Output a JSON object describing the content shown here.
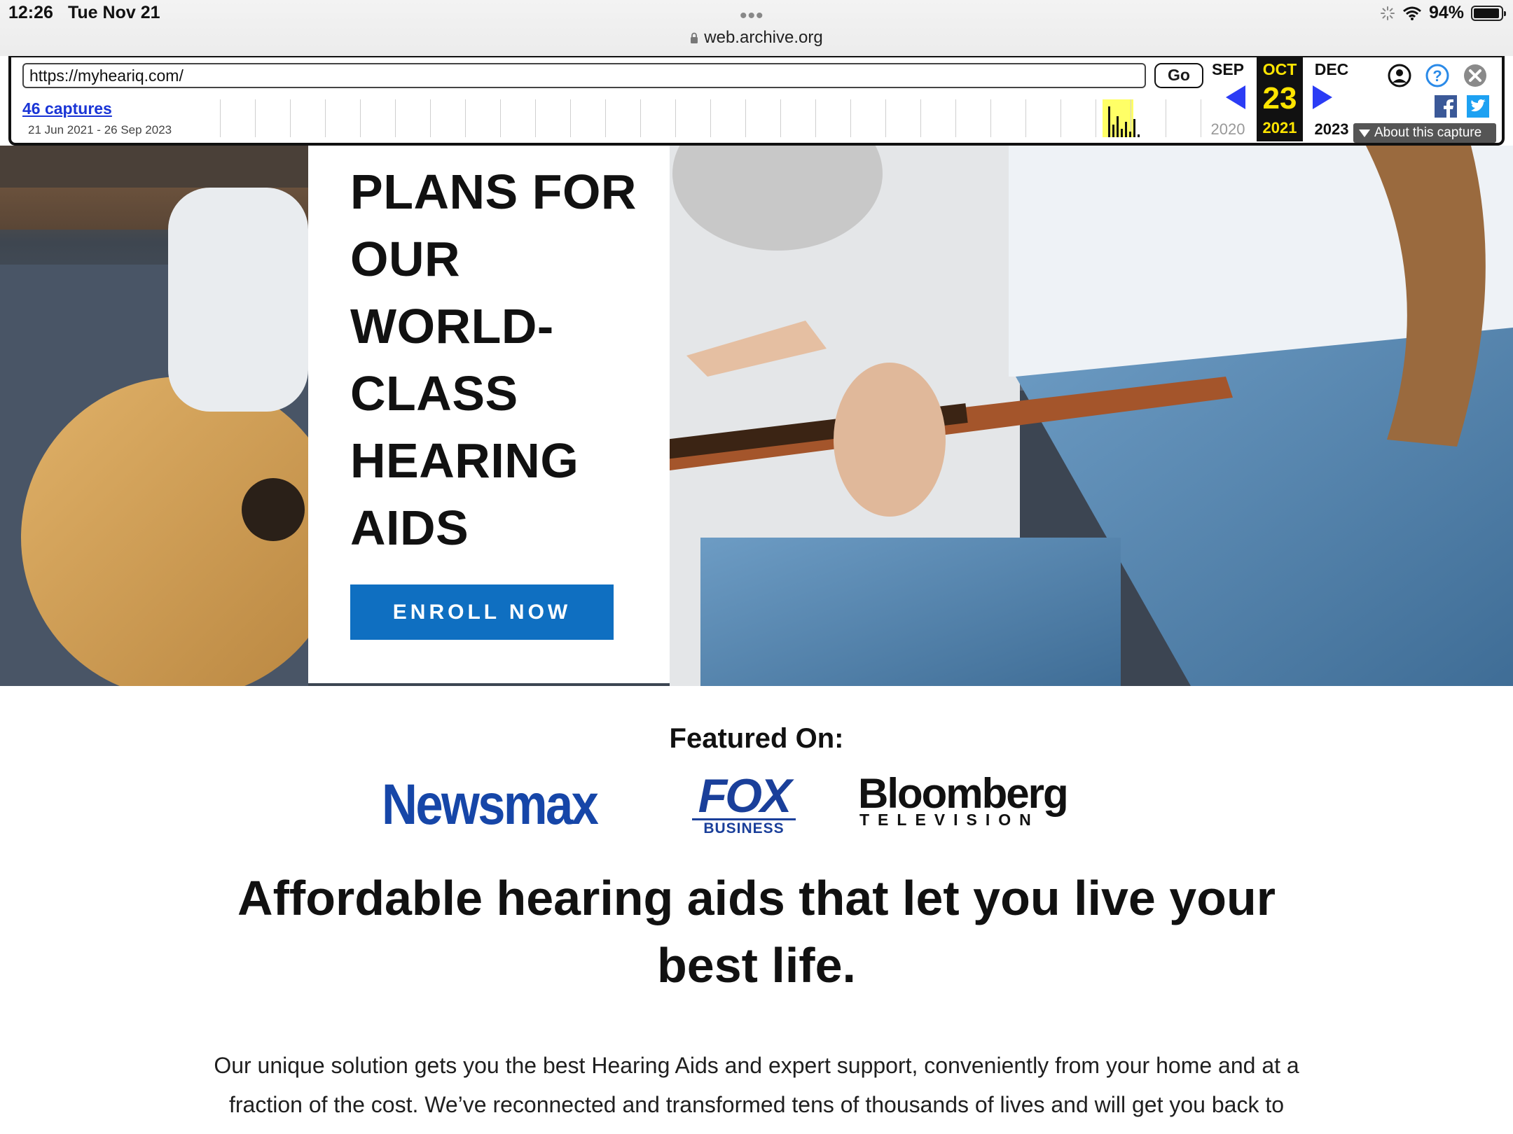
{
  "status_bar": {
    "time": "12:26",
    "date": "Tue Nov 21",
    "url": "web.archive.org",
    "battery": "94%",
    "battery_level": 0.94
  },
  "wayback": {
    "url_value": "https://myheariq.com/",
    "go_label": "Go",
    "captures_link": "46 captures",
    "range": "21 Jun 2021 - 26 Sep 2023",
    "prev_month": "SEP",
    "current_month": "OCT",
    "next_month": "DEC",
    "current_day": "23",
    "prev_year": "2020",
    "current_year": "2021",
    "next_year": "2023",
    "about_label": "About this capture",
    "accent_color": "#ffe500",
    "arrow_color": "#2b3cf5"
  },
  "hero": {
    "heading": "PLANS FOR\nOUR\nWORLD-\nCLASS\nHEARING\nAIDS",
    "enroll_label": "ENROLL NOW",
    "button_color": "#0f6fc1"
  },
  "featured": {
    "title": "Featured On:",
    "logos": {
      "newsmax": "Newsmax",
      "fox_main": "FOX",
      "fox_sub": "BUSINESS",
      "bloomberg_main": "Bloomberg",
      "bloomberg_sub": "TELEVISION"
    }
  },
  "tagline": "Affordable hearing aids that let you live your best life.",
  "body_text": "Our unique solution gets you the best Hearing Aids and expert support, conveniently from your home and at a fraction of the cost. We’ve reconnected and transformed tens of thousands of lives and will get you back to"
}
